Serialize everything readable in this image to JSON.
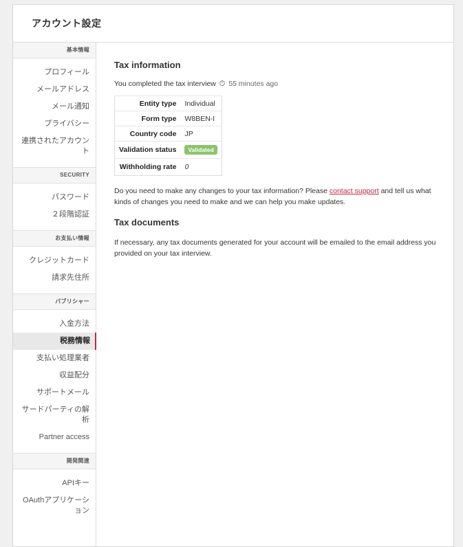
{
  "page": {
    "title": "アカウント設定"
  },
  "sidebar": {
    "sections": [
      {
        "heading": "基本情報",
        "items": [
          "プロフィール",
          "メールアドレス",
          "メール通知",
          "プライバシー",
          "連携されたアカウント"
        ]
      },
      {
        "heading": "SECURITY",
        "items": [
          "パスワード",
          "２段階認証"
        ]
      },
      {
        "heading": "お支払い情報",
        "items": [
          "クレジットカード",
          "請求先住所"
        ]
      },
      {
        "heading": "パブリシャー",
        "items": [
          "入金方法",
          "税務情報",
          "支払い処理業者",
          "収益配分",
          "サポートメール",
          "サードパーティの解析",
          "Partner access"
        ]
      },
      {
        "heading": "開発関連",
        "items": [
          "APIキー",
          "OAuthアプリケーション"
        ]
      }
    ],
    "active_item": "税務情報"
  },
  "main": {
    "tax_info_title": "Tax information",
    "completed_text": "You completed the tax interview",
    "completed_ago": "55 minutes ago",
    "timer_icon": "stopwatch-icon",
    "table": {
      "entity_type_label": "Entity type",
      "entity_type_value": "Individual",
      "form_type_label": "Form type",
      "form_type_value": "W8BEN-I",
      "country_code_label": "Country code",
      "country_code_value": "JP",
      "validation_status_label": "Validation status",
      "validation_status_value": "Validated",
      "withholding_rate_label": "Withholding rate",
      "withholding_rate_value": "0"
    },
    "changes_text_before": "Do you need to make any changes to your tax information? Please ",
    "contact_link": "contact support",
    "changes_text_after": " and tell us what kinds of changes you need to make and we can help you make updates.",
    "tax_docs_title": "Tax documents",
    "tax_docs_text": "If necessary, any tax documents generated for your account will be emailed to the email address you provided on your tax interview."
  },
  "colors": {
    "accent": "#c0283c",
    "badge": "#8bc46b"
  }
}
